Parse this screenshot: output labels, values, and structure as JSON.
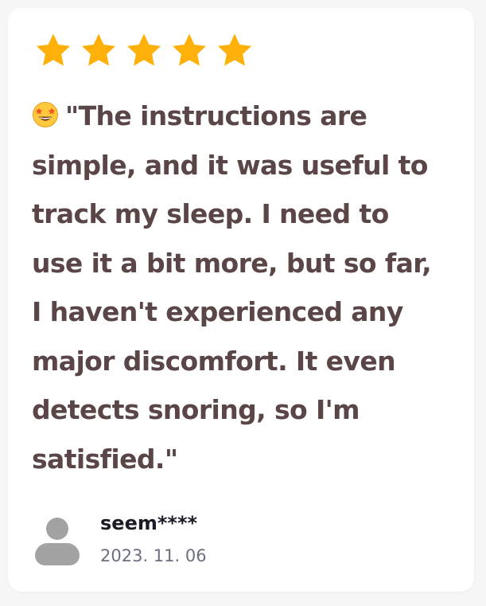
{
  "review": {
    "rating": 5,
    "max_rating": 5,
    "emoji": "star-struck",
    "text": "\"The instructions are simple, and it was useful to track my sleep. I need to use it a bit more, but so far, I haven't experienced any major discomfort. It even detects snoring, so I'm satisfied.\"",
    "reviewer_name": "seem****",
    "date": "2023. 11. 06"
  },
  "colors": {
    "star": "#ffb10a",
    "text": "#5a4646",
    "name": "#1b1c25",
    "date": "#6b7080",
    "avatar": "#a3a3a3",
    "card": "#ffffff"
  }
}
